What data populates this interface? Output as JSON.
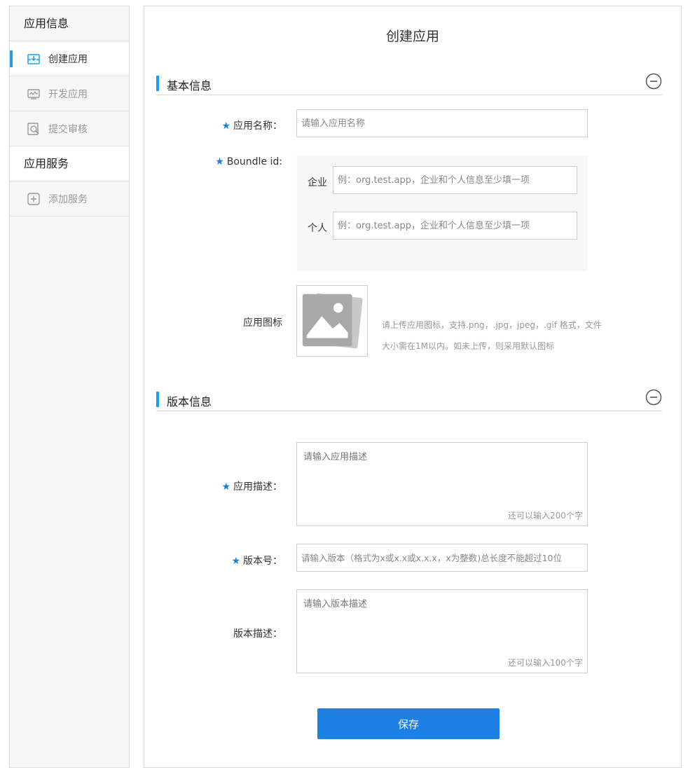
{
  "sidebar": {
    "group_app_info": "应用信息",
    "items": [
      {
        "label": "创建应用",
        "icon": "create-app-icon",
        "active": true
      },
      {
        "label": "开发应用",
        "icon": "develop-app-icon",
        "active": false
      },
      {
        "label": "提交审核",
        "icon": "submit-review-icon",
        "active": false
      }
    ],
    "group_app_service": "应用服务",
    "service_items": [
      {
        "label": "添加服务",
        "icon": "add-service-icon",
        "active": false
      }
    ]
  },
  "main": {
    "title": "创建应用",
    "basic_section": {
      "title": "基本信息",
      "app_name": {
        "label": "应用名称：",
        "placeholder": "请输入应用名称"
      },
      "bundle_id": {
        "label": "Boundle id:",
        "enterprise_label": "企业",
        "enterprise_placeholder": "例：org.test.app，企业和个人信息至少填一项",
        "personal_label": "个人",
        "personal_placeholder": "例：org.test.app，企业和个人信息至少填一项"
      },
      "app_icon": {
        "label": "应用图标",
        "hint_line1": "请上传应用图标，支持.png，.jpg，jpeg，.gif 格式，文件",
        "hint_line2": "大小需在1M以内。如未上传，则采用默认图标"
      }
    },
    "version_section": {
      "title": "版本信息",
      "app_desc": {
        "label": "应用描述：",
        "placeholder": "请输入应用描述",
        "counter": "还可以输入200个字"
      },
      "version_no": {
        "label": "版本号：",
        "placeholder": "请输入版本（格式为x或x.x或x.x.x，x为整数)总长度不能超过10位"
      },
      "version_desc": {
        "label": "版本描述：",
        "placeholder": "请输入版本描述",
        "counter": "还可以输入100个字"
      }
    },
    "save_label": "保存"
  },
  "colors": {
    "accent": "#1a9ff0",
    "button": "#1f80e3",
    "required_star": "#1a7fd8"
  }
}
